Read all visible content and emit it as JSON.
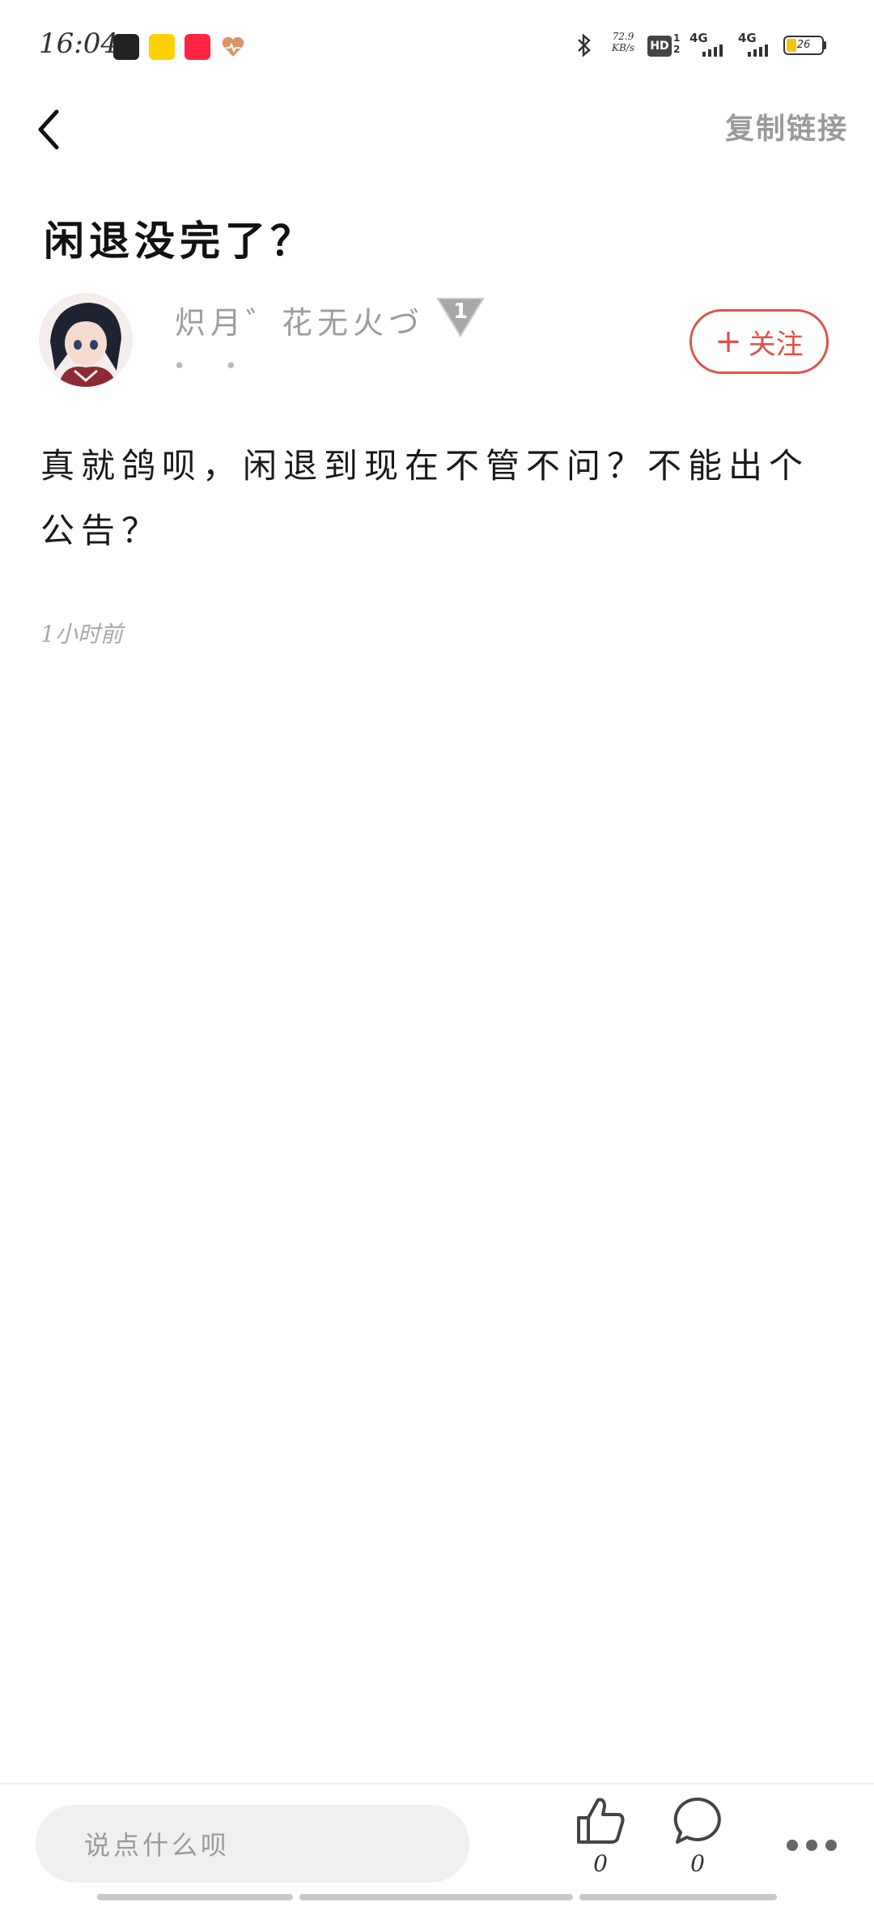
{
  "status_bar": {
    "time": "16:04",
    "app_icons": [
      {
        "name": "soul-app-icon",
        "label": "Soul",
        "color": "#222222"
      },
      {
        "name": "meituan-app-icon",
        "label": "美团",
        "color": "#ffd100"
      },
      {
        "name": "xiaohongshu-app-icon",
        "label": "小红书",
        "color": "#ff2442"
      },
      {
        "name": "health-app-icon",
        "label": "",
        "color": "#d9956a"
      }
    ],
    "net_speed_value": "72.9",
    "net_speed_unit": "KB/s",
    "hd_label": "HD",
    "sim_slot": "1 2",
    "signal_1": "4G",
    "signal_2": "4G",
    "battery": "26"
  },
  "header": {
    "copy_link_label": "复制链接"
  },
  "post": {
    "title": "闲退没完了？",
    "author_name": "炽月゛花无火づ",
    "author_level": "1",
    "author_sub": "• •",
    "follow_label": "关注",
    "follow_plus": "+",
    "body": "真就鸽呗，闲退到现在不管不问？不能出个公告？",
    "time_ago": "1小时前"
  },
  "bottom_bar": {
    "comment_placeholder": "说点什么呗",
    "like_count": "0",
    "comment_count": "0"
  },
  "colors": {
    "accent_red": "#e0524a",
    "muted_gray": "#9a9a9a"
  }
}
